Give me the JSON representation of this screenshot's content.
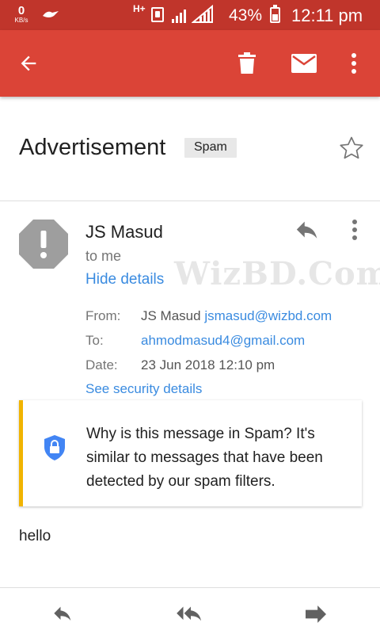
{
  "status_bar": {
    "data_speed_value": "0",
    "data_speed_unit": "KB/s",
    "network_type": "H+",
    "battery_percent": "43%",
    "time": "12:11 pm"
  },
  "toolbar": {
    "icons": [
      "back-arrow-icon",
      "delete-icon",
      "mark-unread-icon",
      "more-vert-icon"
    ]
  },
  "message": {
    "subject": "Advertisement",
    "label": "Spam",
    "sender_name": "JS Masud",
    "recipient_summary": "to me",
    "hide_details": "Hide details",
    "details": {
      "from_label": "From:",
      "from_name": "JS Masud",
      "from_email": "jsmasud@wizbd.com",
      "to_label": "To:",
      "to_email": "ahmodmasud4@gmail.com",
      "date_label": "Date:",
      "date_value": "23 Jun 2018 12:10 pm",
      "security_link": "See security details"
    },
    "spam_warning": "Why is this message in Spam? It's similar to messages that have been detected by our spam filters.",
    "body": "hello"
  },
  "watermark": "WizBD.Com",
  "colors": {
    "status_bar": "#c0352b",
    "toolbar": "#db4437",
    "link": "#3a8be0",
    "warning_accent": "#f1b400",
    "shield": "#4285f4"
  }
}
